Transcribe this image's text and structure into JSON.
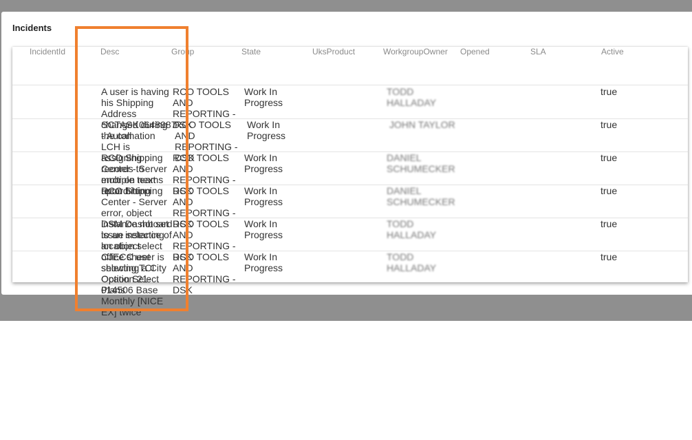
{
  "panel": {
    "title": "Incidents"
  },
  "columns": [
    "IncidentId",
    "Desc",
    "Group",
    "State",
    "UksProduct",
    "WorkgroupOwner",
    "Opened",
    "SLA",
    "Active"
  ],
  "rows": [
    {
      "id": "",
      "desc": "A user is having his Shipping Address changed during the call",
      "group": "RCO TOOLS AND REPORTING - DSK",
      "state": "Work In Progress",
      "product": "",
      "owner": "TODD HALLADAY",
      "opened": "",
      "sla": "",
      "active": "true"
    },
    {
      "id": "",
      "desc": "SCTASK0648987 - Automation LCH is assigning records to multiple teams upon hitting",
      "group": "RCO TOOLS AND REPORTING - DSK",
      "state": "Work In Progress",
      "product": "",
      "owner": "JOHN TAYLOR",
      "opened": "",
      "sla": "",
      "active": "true"
    },
    {
      "id": "",
      "desc": "RCO Shipping Center - Server error on next record",
      "group": "RCO TOOLS AND REPORTING - DSK",
      "state": "Work In Progress",
      "product": "",
      "owner": "DANIEL SCHUMECKER",
      "opened": "",
      "sla": "",
      "active": "true"
    },
    {
      "id": "",
      "desc": "RCO Shipping Center - Server error, object instance not set to an instance of an object",
      "group": "RCO TOOLS AND REPORTING - DSK",
      "state": "Work In Progress",
      "product": "",
      "owner": "DANIEL SCHUMECKER",
      "opened": "",
      "sla": "",
      "active": "true"
    },
    {
      "id": "",
      "desc": "DSM Dashboard issue selecting location select office sheet showing TCI Option Select Plans",
      "group": "RCO TOOLS AND REPORTING - DSK",
      "state": "Work In Progress",
      "product": "",
      "owner": "TODD HALLADAY",
      "opened": "",
      "sla": "",
      "active": "true"
    },
    {
      "id": "",
      "desc": "CJECC user is selecting a City Ocation 21-014506 Base Monthly [NICE EX] twice",
      "group": "RCO TOOLS AND REPORTING - DSK",
      "state": "Work In Progress",
      "product": "",
      "owner": "TODD HALLADAY",
      "opened": "",
      "sla": "",
      "active": "true"
    }
  ]
}
